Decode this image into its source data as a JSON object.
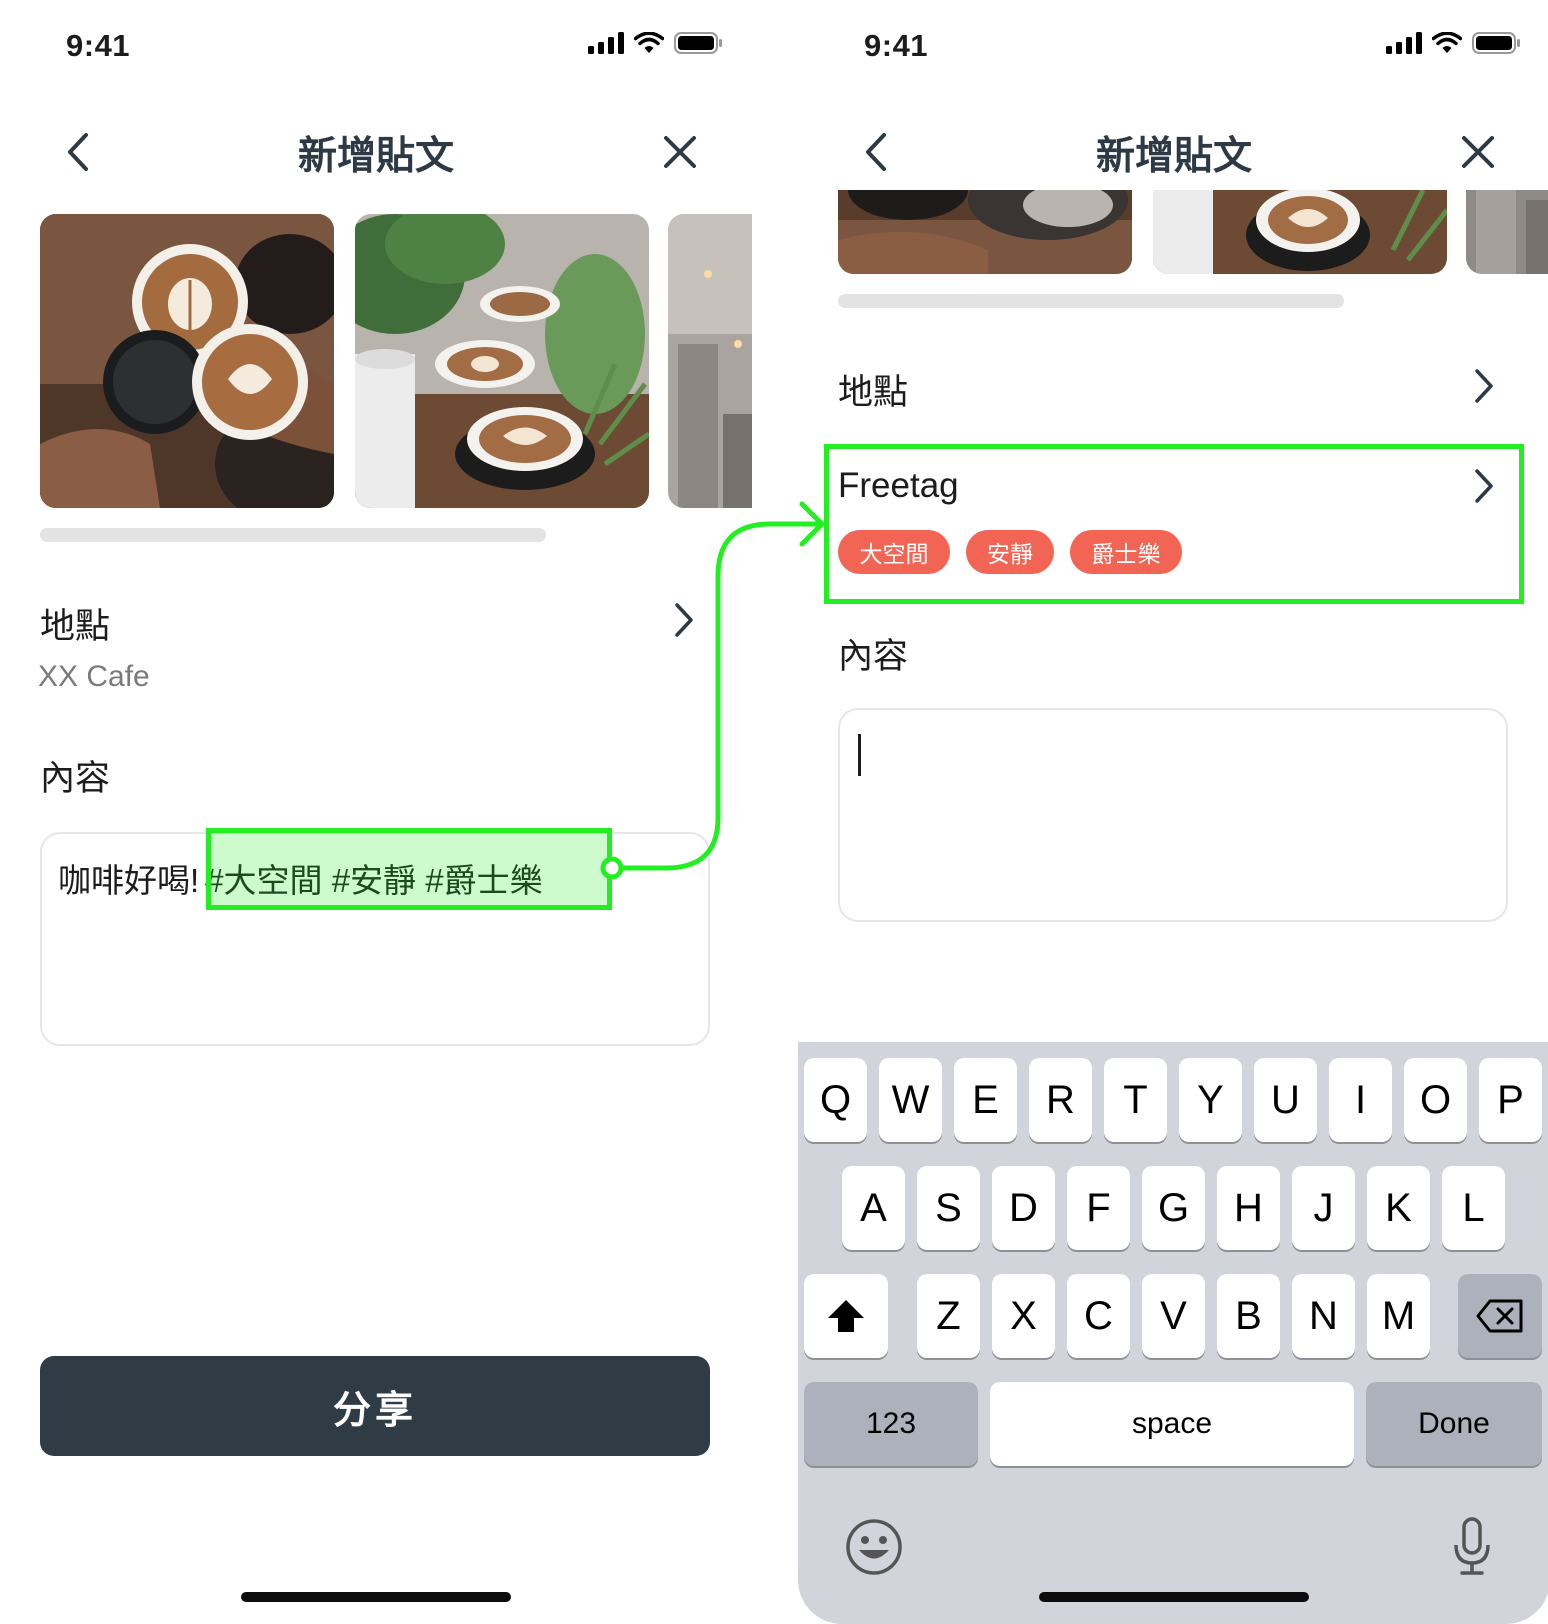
{
  "status_bar": {
    "time": "9:41"
  },
  "left_screen": {
    "nav_title": "新增貼文",
    "location_label": "地點",
    "location_value": "XX Cafe",
    "content_label": "內容",
    "content_text_plain": "咖啡好喝!",
    "content_text_tags": "#大空間 #安靜 #爵士樂",
    "share_label": "分享"
  },
  "right_screen": {
    "nav_title": "新增貼文",
    "location_label": "地點",
    "freetag_label": "Freetag",
    "tags": [
      "大空間",
      "安靜",
      "爵士樂"
    ],
    "content_label": "內容"
  },
  "keyboard": {
    "row1": [
      "Q",
      "W",
      "E",
      "R",
      "T",
      "Y",
      "U",
      "I",
      "O",
      "P"
    ],
    "row2": [
      "A",
      "S",
      "D",
      "F",
      "G",
      "H",
      "J",
      "K",
      "L"
    ],
    "row3": [
      "Z",
      "X",
      "C",
      "V",
      "B",
      "N",
      "M"
    ],
    "numbers_label": "123",
    "space_label": "space",
    "done_label": "Done"
  },
  "colors": {
    "highlight": "#22ee22",
    "tag": "#f26454",
    "button": "#2f3b45",
    "keyboard_bg": "#d1d4db"
  }
}
